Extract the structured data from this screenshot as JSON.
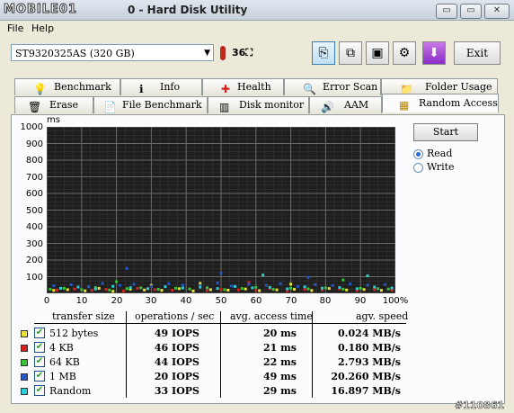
{
  "window": {
    "logo_text": "MOBILE01",
    "title": "0 - Hard Disk Utility",
    "buttons": [
      "▭",
      "▭",
      "✕"
    ]
  },
  "menu": [
    "File",
    "Help"
  ],
  "toolbar": {
    "disk_selected": "ST9320325AS (320 GB)",
    "temperature": "36",
    "exit_label": "Exit"
  },
  "tabs_row1": [
    {
      "label": "Benchmark",
      "icon": "lightbulb-icon",
      "glyph": "💡"
    },
    {
      "label": "Info",
      "icon": "info-icon",
      "glyph": "ℹ"
    },
    {
      "label": "Health",
      "icon": "health-cross-icon",
      "glyph": "✚"
    },
    {
      "label": "Error Scan",
      "icon": "magnifier-icon",
      "glyph": "🔍"
    },
    {
      "label": "Folder Usage",
      "icon": "folder-icon",
      "glyph": "📁"
    }
  ],
  "tabs_row2": [
    {
      "label": "Erase",
      "icon": "trash-icon",
      "glyph": "🗑"
    },
    {
      "label": "File Benchmark",
      "icon": "file-icon",
      "glyph": "📄"
    },
    {
      "label": "Disk monitor",
      "icon": "bar-chart-icon",
      "glyph": "▥"
    },
    {
      "label": "AAM",
      "icon": "speaker-icon",
      "glyph": "🔊"
    },
    {
      "label": "Random Access",
      "icon": "random-grid-icon",
      "glyph": "▦"
    }
  ],
  "controls": {
    "start_label": "Start",
    "read_label": "Read",
    "write_label": "Write",
    "read_selected": true
  },
  "table": {
    "headers": [
      "transfer size",
      "operations / sec",
      "avg. access time",
      "agv. speed"
    ],
    "rows": [
      {
        "name": "512 bytes",
        "color": "#e8e23a",
        "ops": "49 IOPS",
        "time": "20 ms",
        "speed": "0.024 MB/s"
      },
      {
        "name": "4 KB",
        "color": "#d41f1f",
        "ops": "46 IOPS",
        "time": "21 ms",
        "speed": "0.180 MB/s"
      },
      {
        "name": "64 KB",
        "color": "#36c436",
        "ops": "44 IOPS",
        "time": "22 ms",
        "speed": "2.793 MB/s"
      },
      {
        "name": "1 MB",
        "color": "#2456c8",
        "ops": "20 IOPS",
        "time": "49 ms",
        "speed": "20.260 MB/s"
      },
      {
        "name": "Random",
        "color": "#2ccfd6",
        "ops": "33 IOPS",
        "time": "29 ms",
        "speed": "16.897 MB/s"
      }
    ]
  },
  "watermark": "#110861",
  "chart_data": {
    "type": "scatter",
    "title": "",
    "xlabel": "",
    "ylabel": "ms",
    "xlim": [
      0,
      100
    ],
    "ylim": [
      0,
      1000
    ],
    "x_ticks": [
      "0",
      "10",
      "20",
      "30",
      "40",
      "50",
      "60",
      "70",
      "80",
      "90",
      "100%"
    ],
    "y_ticks": [
      "1000",
      "900",
      "800",
      "700",
      "600",
      "500",
      "400",
      "300",
      "200",
      "100"
    ],
    "grid": true,
    "series": [
      {
        "color": "#e8e23a",
        "points": [
          [
            2,
            18
          ],
          [
            6,
            22
          ],
          [
            11,
            15
          ],
          [
            15,
            30
          ],
          [
            19,
            12
          ],
          [
            24,
            25
          ],
          [
            28,
            20
          ],
          [
            33,
            18
          ],
          [
            38,
            28
          ],
          [
            42,
            14
          ],
          [
            47,
            22
          ],
          [
            52,
            19
          ],
          [
            57,
            26
          ],
          [
            61,
            16
          ],
          [
            66,
            21
          ],
          [
            71,
            24
          ],
          [
            76,
            17
          ],
          [
            81,
            29
          ],
          [
            86,
            20
          ],
          [
            91,
            23
          ],
          [
            96,
            18
          ],
          [
            44,
            60
          ],
          [
            70,
            55
          ],
          [
            30,
            48
          ]
        ]
      },
      {
        "color": "#d41f1f",
        "points": [
          [
            3,
            20
          ],
          [
            8,
            26
          ],
          [
            13,
            18
          ],
          [
            17,
            24
          ],
          [
            22,
            14
          ],
          [
            26,
            30
          ],
          [
            31,
            22
          ],
          [
            36,
            19
          ],
          [
            41,
            27
          ],
          [
            46,
            16
          ],
          [
            50,
            24
          ],
          [
            55,
            21
          ],
          [
            60,
            18
          ],
          [
            64,
            28
          ],
          [
            69,
            15
          ],
          [
            74,
            23
          ],
          [
            79,
            20
          ],
          [
            84,
            26
          ],
          [
            89,
            17
          ],
          [
            94,
            22
          ],
          [
            99,
            19
          ],
          [
            58,
            65
          ]
        ]
      },
      {
        "color": "#36c436",
        "points": [
          [
            1,
            25
          ],
          [
            5,
            30
          ],
          [
            10,
            22
          ],
          [
            14,
            35
          ],
          [
            18,
            20
          ],
          [
            23,
            28
          ],
          [
            27,
            33
          ],
          [
            32,
            24
          ],
          [
            37,
            31
          ],
          [
            41,
            26
          ],
          [
            46,
            34
          ],
          [
            51,
            22
          ],
          [
            56,
            29
          ],
          [
            60,
            36
          ],
          [
            65,
            24
          ],
          [
            70,
            31
          ],
          [
            75,
            27
          ],
          [
            80,
            33
          ],
          [
            85,
            25
          ],
          [
            90,
            30
          ],
          [
            95,
            28
          ],
          [
            98,
            26
          ],
          [
            20,
            70
          ],
          [
            85,
            80
          ]
        ]
      },
      {
        "color": "#2456c8",
        "points": [
          [
            2,
            45
          ],
          [
            7,
            52
          ],
          [
            12,
            40
          ],
          [
            16,
            60
          ],
          [
            21,
            48
          ],
          [
            25,
            55
          ],
          [
            30,
            42
          ],
          [
            35,
            58
          ],
          [
            39,
            50
          ],
          [
            44,
            46
          ],
          [
            49,
            62
          ],
          [
            53,
            44
          ],
          [
            58,
            54
          ],
          [
            63,
            48
          ],
          [
            67,
            58
          ],
          [
            72,
            41
          ],
          [
            77,
            52
          ],
          [
            82,
            47
          ],
          [
            87,
            56
          ],
          [
            92,
            49
          ],
          [
            97,
            53
          ],
          [
            50,
            120
          ],
          [
            23,
            150
          ],
          [
            75,
            95
          ]
        ]
      },
      {
        "color": "#2ccfd6",
        "points": [
          [
            4,
            30
          ],
          [
            9,
            38
          ],
          [
            14,
            26
          ],
          [
            19,
            42
          ],
          [
            24,
            34
          ],
          [
            29,
            28
          ],
          [
            34,
            40
          ],
          [
            39,
            32
          ],
          [
            44,
            37
          ],
          [
            49,
            29
          ],
          [
            54,
            41
          ],
          [
            59,
            33
          ],
          [
            64,
            36
          ],
          [
            69,
            27
          ],
          [
            74,
            39
          ],
          [
            79,
            31
          ],
          [
            84,
            35
          ],
          [
            89,
            28
          ],
          [
            94,
            38
          ],
          [
            99,
            32
          ],
          [
            62,
            110
          ],
          [
            92,
            105
          ]
        ]
      }
    ]
  }
}
